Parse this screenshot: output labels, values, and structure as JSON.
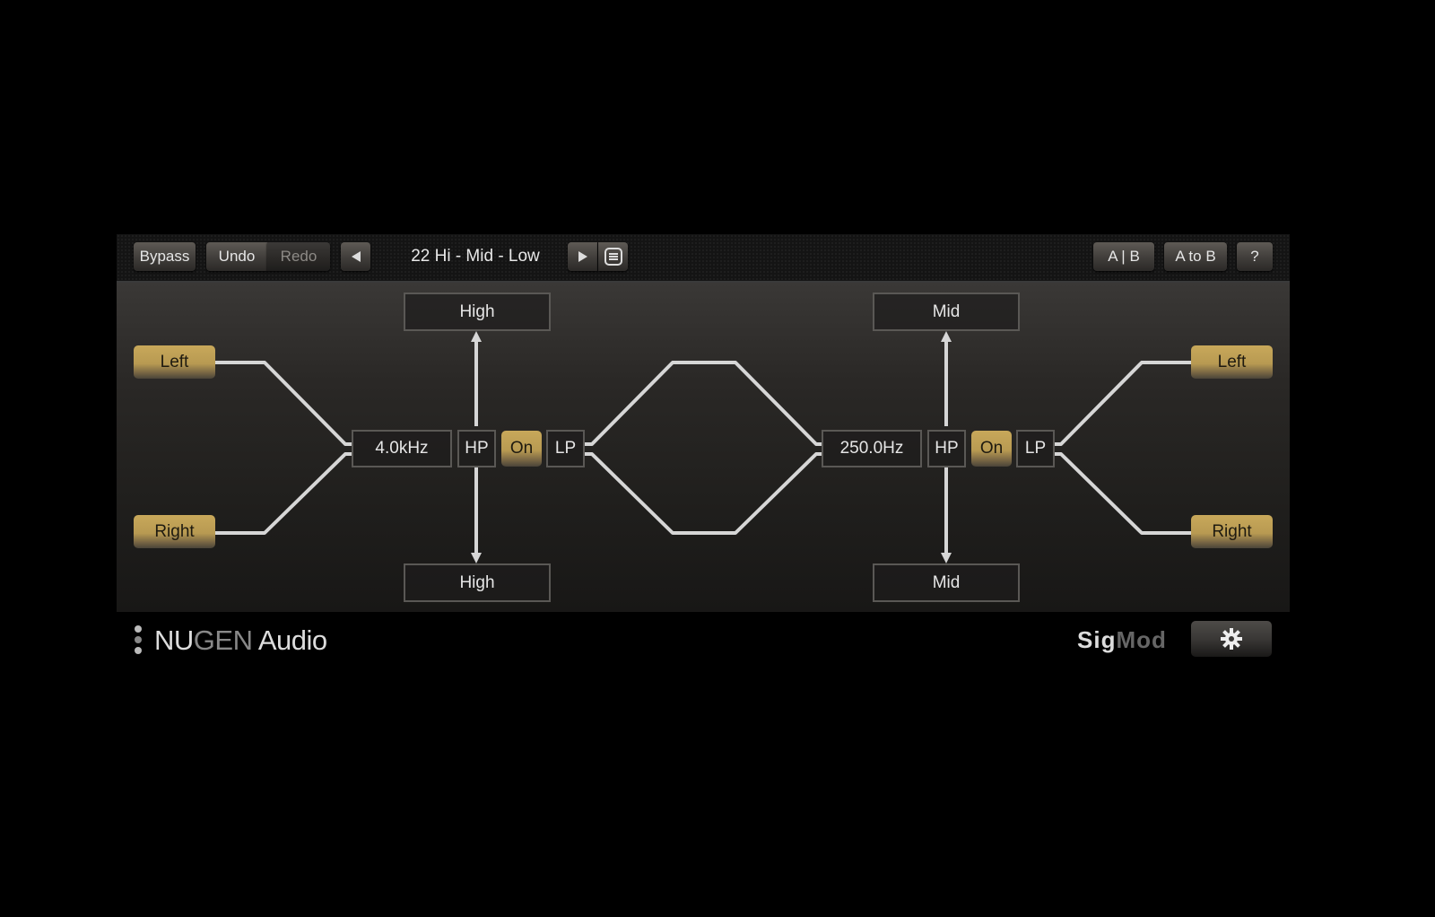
{
  "toolbar": {
    "bypass_label": "Bypass",
    "undo_label": "Undo",
    "redo_label": "Redo",
    "prev_preset_icon": "triangle-left-icon",
    "preset_name": "22 Hi - Mid - Low",
    "next_preset_icon": "triangle-right-icon",
    "preset_list_icon": "list-icon",
    "ab_label": "A | B",
    "a_to_b_label": "A to B",
    "help_label": "?"
  },
  "routing": {
    "inputs": {
      "left": "Left",
      "right": "Right"
    },
    "outputs": {
      "left": "Left",
      "right": "Right"
    },
    "split1": {
      "frequency": "4.0kHz",
      "hp_label": "HP",
      "on_label": "On",
      "lp_label": "LP",
      "top_output": "High",
      "bottom_output": "High"
    },
    "split2": {
      "frequency": "250.0Hz",
      "hp_label": "HP",
      "on_label": "On",
      "lp_label": "LP",
      "top_output": "Mid",
      "bottom_output": "Mid"
    }
  },
  "footer": {
    "brand_nu": "NU",
    "brand_gen": "GEN",
    "brand_audio": " Audio",
    "product_sig": "Sig",
    "product_mod": "Mod",
    "settings_icon": "gear-icon"
  },
  "colors": {
    "accent_gold": "#c8a85a",
    "wire": "#d8d8d8"
  }
}
